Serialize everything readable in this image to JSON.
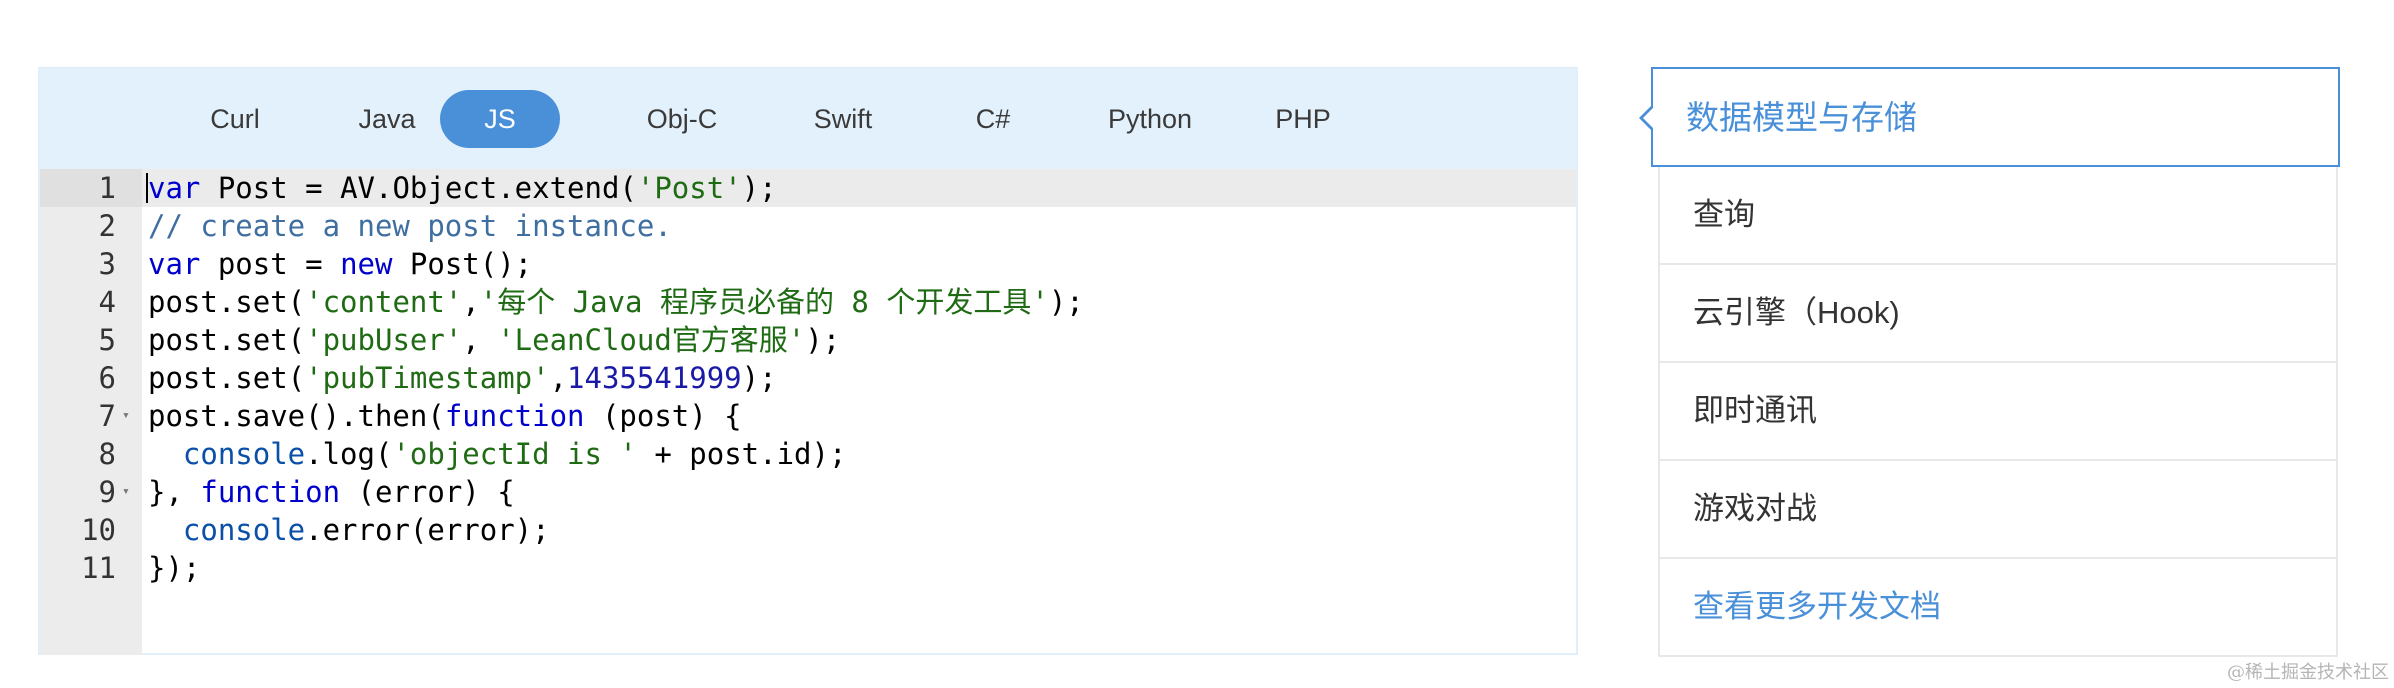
{
  "tabs": [
    "Curl",
    "Java",
    "JS",
    "Obj-C",
    "Swift",
    "C#",
    "Python",
    "PHP"
  ],
  "active_tab": "JS",
  "code_lines": [
    {
      "num": "1",
      "fold": false
    },
    {
      "num": "2",
      "fold": false
    },
    {
      "num": "3",
      "fold": false
    },
    {
      "num": "4",
      "fold": false
    },
    {
      "num": "5",
      "fold": false
    },
    {
      "num": "6",
      "fold": false
    },
    {
      "num": "7",
      "fold": true
    },
    {
      "num": "8",
      "fold": false
    },
    {
      "num": "9",
      "fold": true
    },
    {
      "num": "10",
      "fold": false
    },
    {
      "num": "11",
      "fold": false
    }
  ],
  "code_tokens": [
    [
      [
        "k",
        "var"
      ],
      [
        "p",
        " Post = AV.Object.extend("
      ],
      [
        "s",
        "'Post'"
      ],
      [
        "p",
        ");"
      ]
    ],
    [
      [
        "c",
        "// create a new post instance."
      ]
    ],
    [
      [
        "k",
        "var"
      ],
      [
        "p",
        " post = "
      ],
      [
        "k",
        "new"
      ],
      [
        "p",
        " Post();"
      ]
    ],
    [
      [
        "p",
        "post.set("
      ],
      [
        "s",
        "'content'"
      ],
      [
        "p",
        ","
      ],
      [
        "s",
        "'每个 Java 程序员必备的 8 个开发工具'"
      ],
      [
        "p",
        ");"
      ]
    ],
    [
      [
        "p",
        "post.set("
      ],
      [
        "s",
        "'pubUser'"
      ],
      [
        "p",
        ", "
      ],
      [
        "s",
        "'LeanCloud官方客服'"
      ],
      [
        "p",
        ");"
      ]
    ],
    [
      [
        "p",
        "post.set("
      ],
      [
        "s",
        "'pubTimestamp'"
      ],
      [
        "p",
        ","
      ],
      [
        "n",
        "1435541999"
      ],
      [
        "p",
        ");"
      ]
    ],
    [
      [
        "p",
        "post.save().then("
      ],
      [
        "k",
        "function"
      ],
      [
        "p",
        " (post) {"
      ]
    ],
    [
      [
        "p",
        "  "
      ],
      [
        "v",
        "console"
      ],
      [
        "p",
        ".log("
      ],
      [
        "s",
        "'objectId is '"
      ],
      [
        "p",
        " + post.id);"
      ]
    ],
    [
      [
        "p",
        "}, "
      ],
      [
        "k",
        "function"
      ],
      [
        "p",
        " (error) {"
      ]
    ],
    [
      [
        "p",
        "  "
      ],
      [
        "v",
        "console"
      ],
      [
        "p",
        ".error(error);"
      ]
    ],
    [
      [
        "p",
        "});"
      ]
    ]
  ],
  "sidebar": {
    "title": "数据模型与存储",
    "items": [
      "查询",
      "云引擎（Hook)",
      "即时通讯",
      "游戏对战"
    ],
    "more_link": "查看更多开发文档"
  },
  "watermark": "@稀土掘金技术社区",
  "colors": {
    "accent": "#4a90d9",
    "tabbar_bg": "#e3f1fc",
    "keyword": "#0000cc",
    "string": "#1f6b14",
    "comment": "#3f6fa0"
  },
  "icons": {
    "fold_marker": "fold-caret-icon",
    "side_pointer": "pointer-arrow-icon"
  }
}
